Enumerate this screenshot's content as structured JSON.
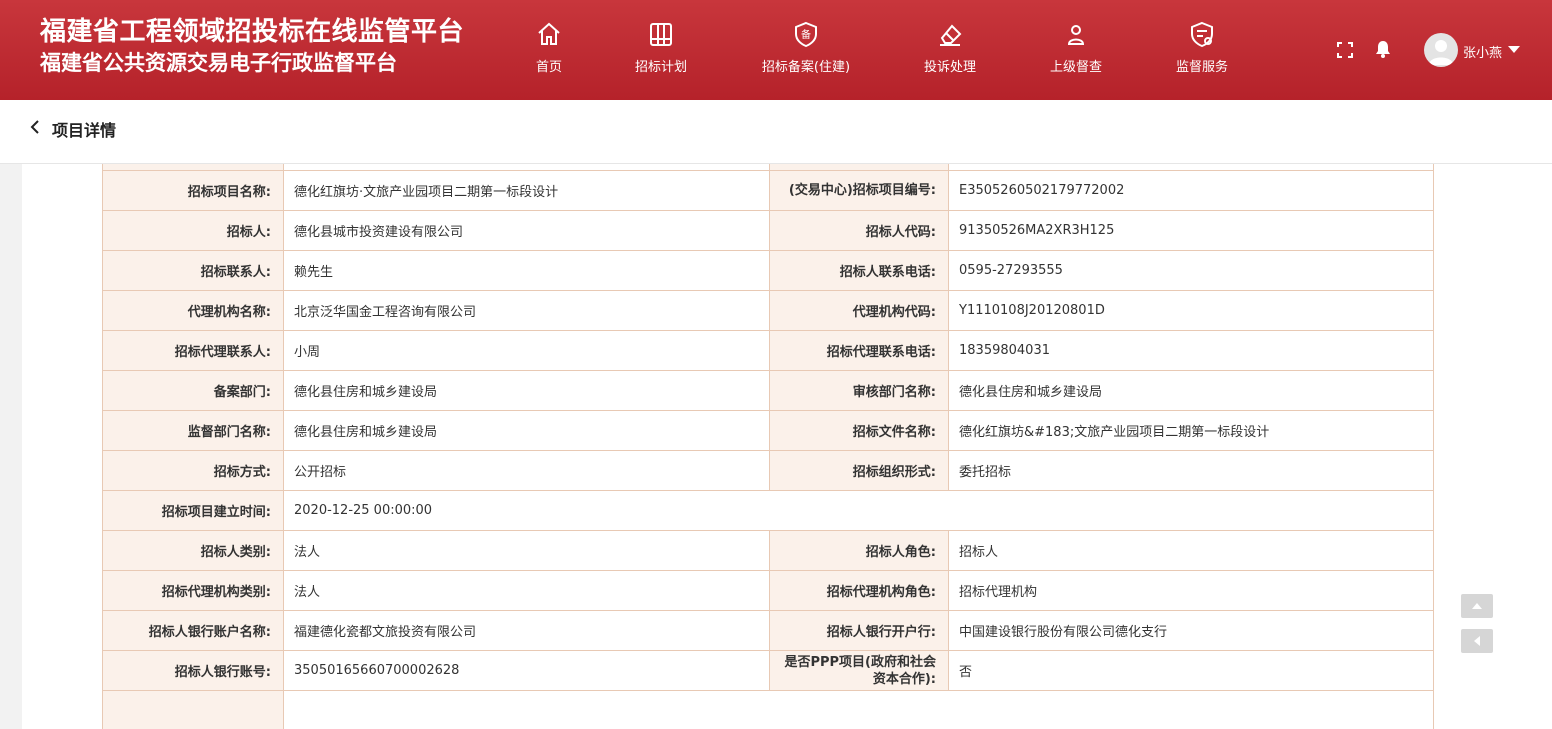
{
  "header": {
    "title_line1": "福建省工程领域招投标在线监管平台",
    "title_line2": "福建省公共资源交易电子行政监督平台",
    "nav": [
      {
        "label": "首页",
        "icon": "home-icon"
      },
      {
        "label": "招标计划",
        "icon": "calendar-icon"
      },
      {
        "label": "招标备案(住建)",
        "icon": "record-shield-icon"
      },
      {
        "label": "投诉处理",
        "icon": "eraser-icon"
      },
      {
        "label": "上级督查",
        "icon": "person-icon"
      },
      {
        "label": "监督服务",
        "icon": "service-shield-icon"
      }
    ],
    "user": "张小燕"
  },
  "page": {
    "title": "项目详情"
  },
  "details": [
    [
      "招标项目名称:",
      "德化红旗坊·文旅产业园项目二期第一标段设计",
      "(交易中心)招标项目编号:",
      "E3505260502179772002"
    ],
    [
      "招标人:",
      "德化县城市投资建设有限公司",
      "招标人代码:",
      "91350526MA2XR3H125"
    ],
    [
      "招标联系人:",
      "赖先生",
      "招标人联系电话:",
      "0595-27293555"
    ],
    [
      "代理机构名称:",
      "北京泛华国金工程咨询有限公司",
      "代理机构代码:",
      "Y1110108J20120801D"
    ],
    [
      "招标代理联系人:",
      "小周",
      "招标代理联系电话:",
      "18359804031"
    ],
    [
      "备案部门:",
      "德化县住房和城乡建设局",
      "审核部门名称:",
      "德化县住房和城乡建设局"
    ],
    [
      "监督部门名称:",
      "德化县住房和城乡建设局",
      "招标文件名称:",
      "德化红旗坊&#183;文旅产业园项目二期第一标段设计"
    ],
    [
      "招标方式:",
      "公开招标",
      "招标组织形式:",
      "委托招标"
    ],
    [
      "招标项目建立时间:",
      "2020-12-25 00:00:00"
    ],
    [
      "招标人类别:",
      "法人",
      "招标人角色:",
      "招标人"
    ],
    [
      "招标代理机构类别:",
      "法人",
      "招标代理机构角色:",
      "招标代理机构"
    ],
    [
      "招标人银行账户名称:",
      "福建德化瓷都文旅投资有限公司",
      "招标人银行开户行:",
      "中国建设银行股份有限公司德化支行"
    ],
    [
      "招标人银行账号:",
      "35050165660700002628",
      "是否PPP项目(政府和社会资本合作):",
      "否"
    ]
  ]
}
